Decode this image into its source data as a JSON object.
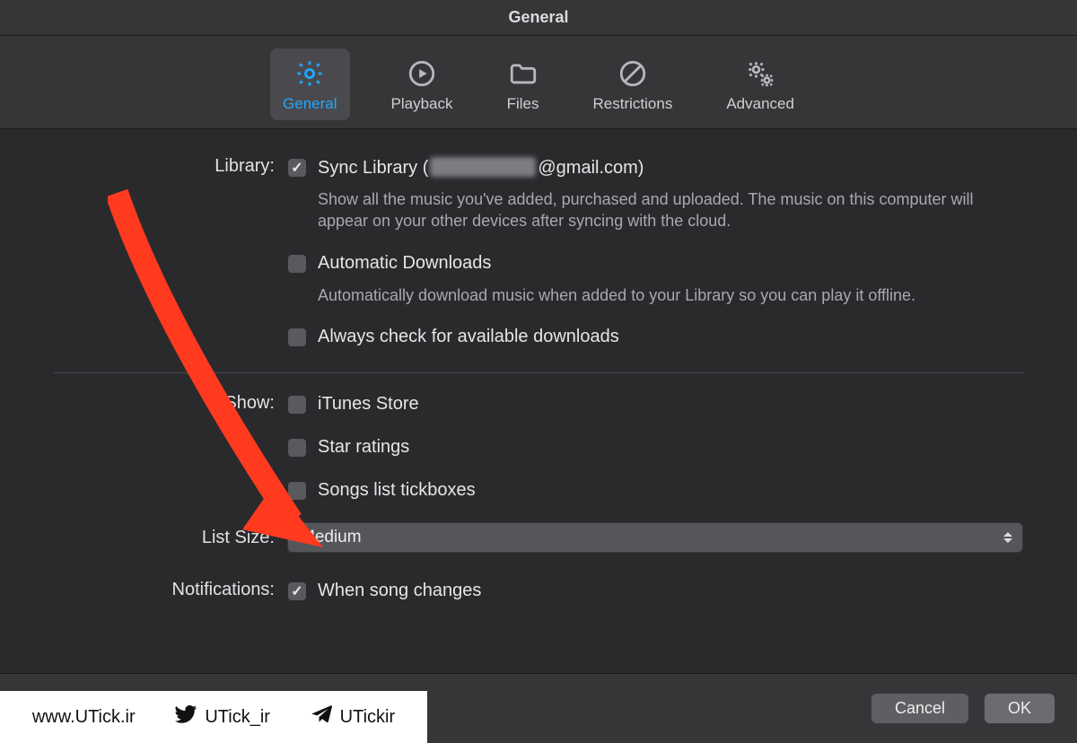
{
  "window": {
    "title": "General"
  },
  "tabs": [
    {
      "id": "general",
      "label": "General",
      "active": true
    },
    {
      "id": "playback",
      "label": "Playback",
      "active": false
    },
    {
      "id": "files",
      "label": "Files",
      "active": false
    },
    {
      "id": "restrictions",
      "label": "Restrictions",
      "active": false
    },
    {
      "id": "advanced",
      "label": "Advanced",
      "active": false
    }
  ],
  "sections": {
    "library": {
      "label": "Library:",
      "sync": {
        "checked": true,
        "label_prefix": "Sync Library (",
        "label_suffix": "@gmail.com)",
        "desc": "Show all the music you've added, purchased and uploaded. The music on this computer will appear on your other devices after syncing with the cloud."
      },
      "auto_downloads": {
        "checked": false,
        "label": "Automatic Downloads",
        "desc": "Automatically download music when added to your Library so you can play it offline."
      },
      "check_downloads": {
        "checked": false,
        "label": "Always check for available downloads"
      }
    },
    "show": {
      "label": "Show:",
      "itunes_store": {
        "checked": false,
        "label": "iTunes Store"
      },
      "star_ratings": {
        "checked": false,
        "label": "Star ratings"
      },
      "tickboxes": {
        "checked": false,
        "label": "Songs list tickboxes"
      }
    },
    "list_size": {
      "label": "List Size:",
      "value": "Medium"
    },
    "notifications": {
      "label": "Notifications:",
      "song_changes": {
        "checked": true,
        "label": "When song changes"
      }
    }
  },
  "footer": {
    "help": "?",
    "cancel": "Cancel",
    "ok": "OK"
  },
  "watermark": {
    "site": "www.UTick.ir",
    "twitter": "UTick_ir",
    "telegram": "UTickir"
  },
  "colors": {
    "accent": "#1fa8ff",
    "arrow": "#ff3a1f"
  }
}
